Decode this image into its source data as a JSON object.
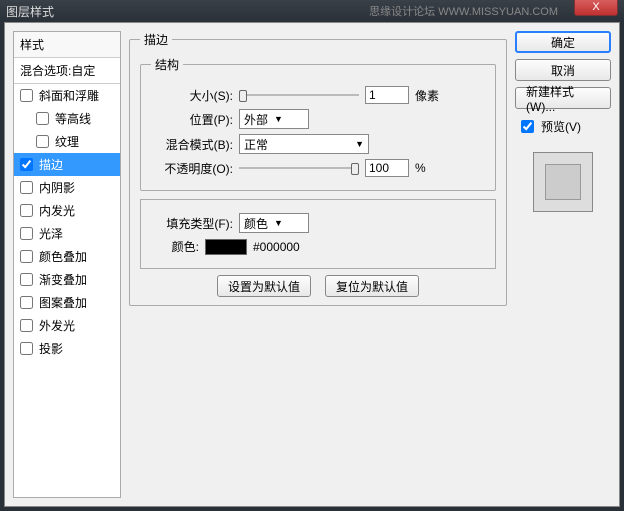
{
  "title": "图层样式",
  "watermark": "思缘设计论坛  WWW.MISSYUAN.COM",
  "close": "X",
  "sidebar": {
    "header": "样式",
    "sub": "混合选项:自定",
    "items": [
      {
        "label": "斜面和浮雕",
        "checked": false,
        "indent": false
      },
      {
        "label": "等高线",
        "checked": false,
        "indent": true
      },
      {
        "label": "纹理",
        "checked": false,
        "indent": true
      },
      {
        "label": "描边",
        "checked": true,
        "indent": false,
        "selected": true
      },
      {
        "label": "内阴影",
        "checked": false,
        "indent": false
      },
      {
        "label": "内发光",
        "checked": false,
        "indent": false
      },
      {
        "label": "光泽",
        "checked": false,
        "indent": false
      },
      {
        "label": "颜色叠加",
        "checked": false,
        "indent": false
      },
      {
        "label": "渐变叠加",
        "checked": false,
        "indent": false
      },
      {
        "label": "图案叠加",
        "checked": false,
        "indent": false
      },
      {
        "label": "外发光",
        "checked": false,
        "indent": false
      },
      {
        "label": "投影",
        "checked": false,
        "indent": false
      }
    ]
  },
  "stroke": {
    "panel_title": "描边",
    "struct_title": "结构",
    "size_label": "大小(S):",
    "size_value": "1",
    "size_unit": "像素",
    "position_label": "位置(P):",
    "position_value": "外部",
    "blend_label": "混合模式(B):",
    "blend_value": "正常",
    "opacity_label": "不透明度(O):",
    "opacity_value": "100",
    "opacity_unit": "%",
    "fill_type_label": "填充类型(F):",
    "fill_type_value": "颜色",
    "color_label": "颜色:",
    "color_hex": "#000000",
    "btn_default": "设置为默认值",
    "btn_reset": "复位为默认值"
  },
  "right": {
    "ok": "确定",
    "cancel": "取消",
    "new_style": "新建样式(W)...",
    "preview_label": "预览(V)",
    "preview_checked": true
  }
}
